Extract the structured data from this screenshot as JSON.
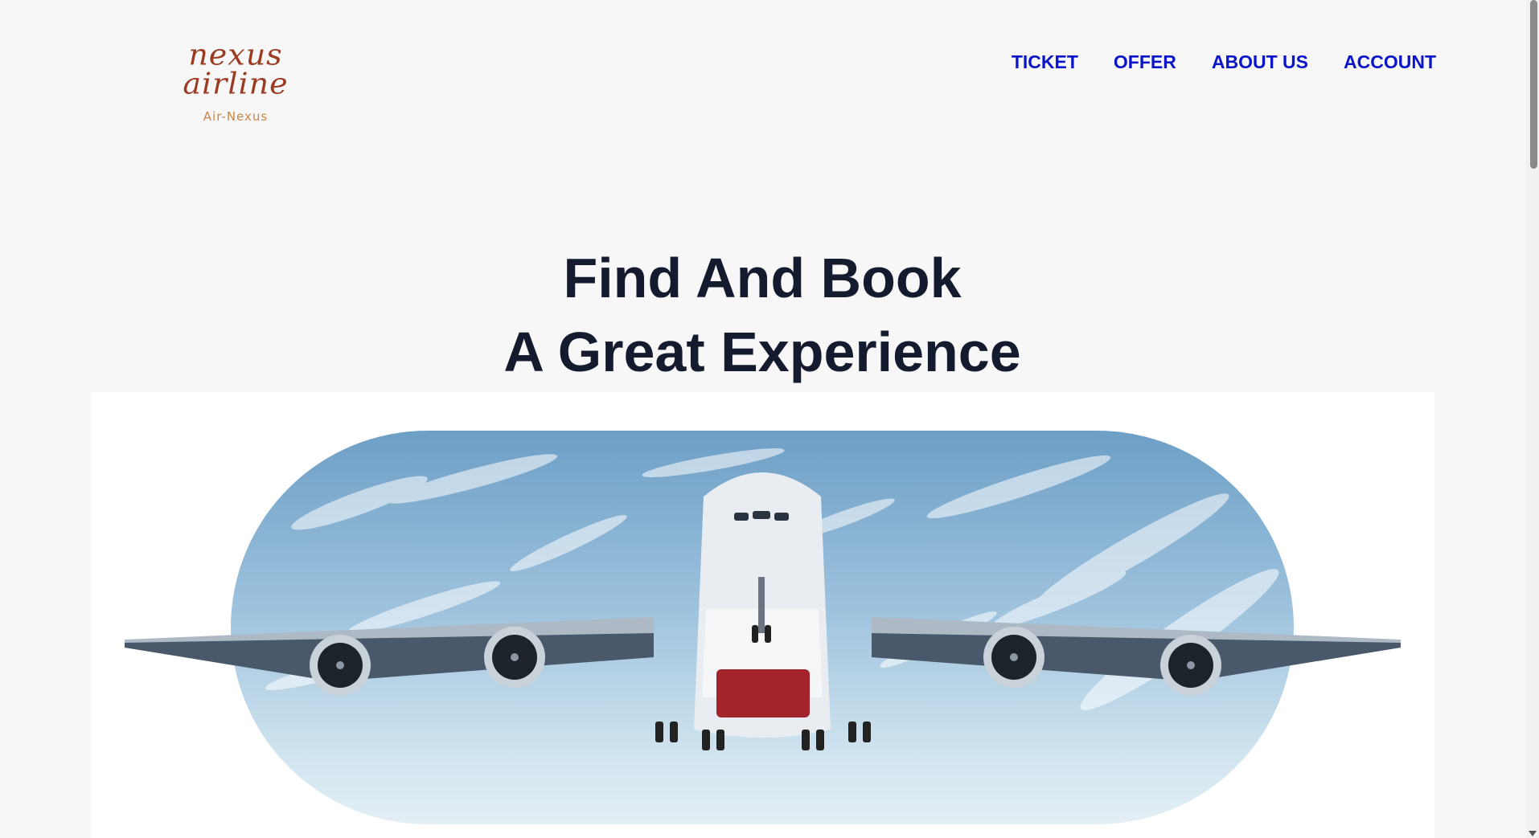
{
  "brand": {
    "name": "nexus airline",
    "tagline": "Air-Nexus"
  },
  "nav": {
    "items": [
      {
        "label": "TICKET"
      },
      {
        "label": "OFFER"
      },
      {
        "label": "ABOUT US"
      },
      {
        "label": "ACCOUNT"
      }
    ]
  },
  "hero": {
    "line1": "Find And Book",
    "line2": "A Great Experience"
  },
  "colors": {
    "nav_link": "#0a14c8",
    "heading": "#141b2e",
    "logo_script": "#9a3b22",
    "logo_tagline": "#c88742",
    "background": "#f7f7f7"
  },
  "icons": {
    "scroll_down": "scroll-down-arrow-icon"
  }
}
